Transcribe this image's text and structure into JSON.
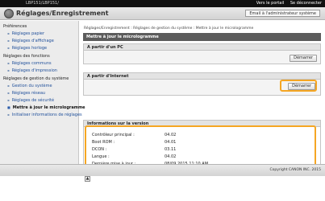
{
  "topbar": {
    "model": "LBP151/LBP151/",
    "portal_link": "Vers le portail",
    "logout_link": "Se déconnecter"
  },
  "header": {
    "title": "Réglages/Enregistrement",
    "mail_button": "Email à l'administrateur système"
  },
  "sidebar": {
    "items": [
      {
        "label": "Préférences",
        "kind": "category"
      },
      {
        "label": "Réglages papier",
        "kind": "sub"
      },
      {
        "label": "Réglages d'affichage",
        "kind": "sub"
      },
      {
        "label": "Réglages horloge",
        "kind": "sub"
      },
      {
        "label": "Réglages des fonctions",
        "kind": "category"
      },
      {
        "label": "Réglages communs",
        "kind": "sub"
      },
      {
        "label": "Réglages d'impression",
        "kind": "sub"
      },
      {
        "label": "Réglages de gestion du système",
        "kind": "category"
      },
      {
        "label": "Gestion du système",
        "kind": "sub"
      },
      {
        "label": "Réglages réseau",
        "kind": "sub"
      },
      {
        "label": "Réglages de sécurité",
        "kind": "sub"
      },
      {
        "label": "Mettre à jour le micrologramme",
        "kind": "active"
      },
      {
        "label": "Initialiser informations de réglages",
        "kind": "sub"
      }
    ]
  },
  "main": {
    "breadcrumb": "Réglages/Enregistrement : Réglages de gestion du système : Mettre à jour le micrologramme",
    "page_title": "Mettre à jour le micrologramme",
    "from_pc": {
      "label": "A partir d'un PC",
      "button": "Démarrer"
    },
    "from_internet": {
      "label": "A partir d'Internet",
      "button": "Démarrer"
    },
    "version_info": {
      "label": "Informations sur la version",
      "rows": [
        {
          "key": "Contrôleur principal :",
          "value": "04.02"
        },
        {
          "key": "Boot ROM :",
          "value": "04.01"
        },
        {
          "key": "DCON :",
          "value": "03.11"
        },
        {
          "key": "Langue :",
          "value": "04.02"
        },
        {
          "key": "Dernière mise à jour :",
          "value": "08/09 2015 11:10 AM"
        }
      ]
    },
    "back_glyph": "▲"
  },
  "footer": {
    "copyright": "Copyright CANON INC. 2015"
  },
  "colors": {
    "highlight": "#f5a623",
    "title_bar": "#5c5c5c",
    "link": "#1f4f9a"
  }
}
